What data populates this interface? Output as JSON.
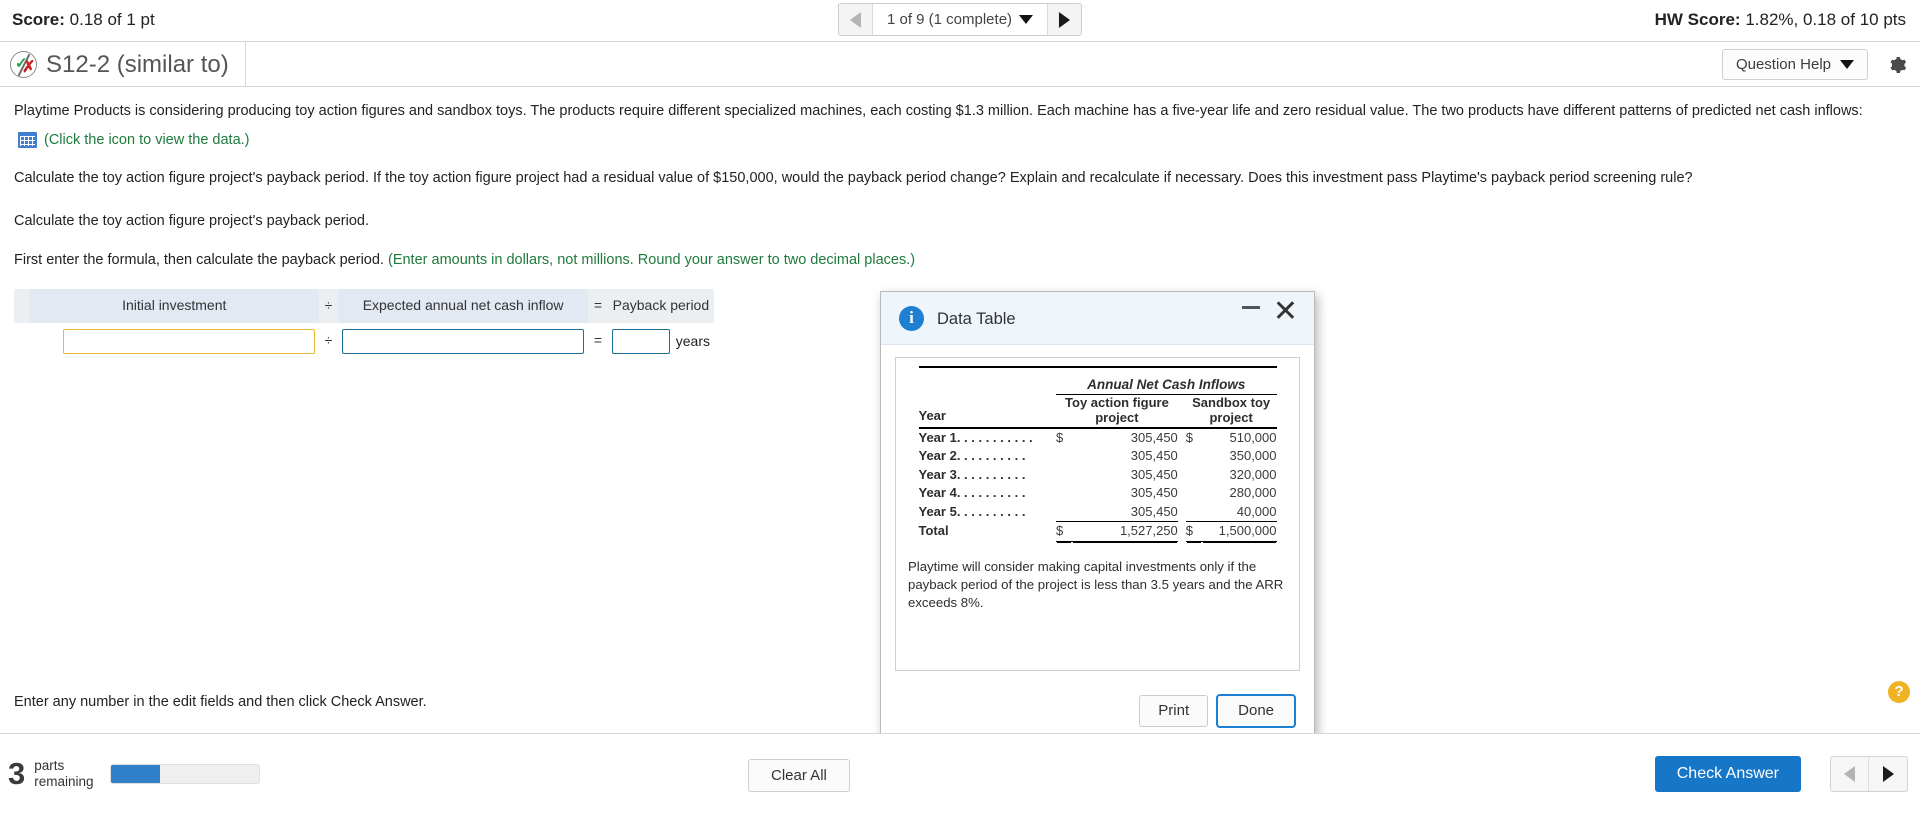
{
  "topbar": {
    "score_label": "Score:",
    "score_value": "0.18 of 1 pt",
    "hw_score_label": "HW Score:",
    "hw_score_value": "1.82%, 0.18 of 10 pts",
    "nav_label": "1 of 9 (1 complete)"
  },
  "question_header": {
    "title": "S12-2 (similar to)",
    "help_button": "Question Help"
  },
  "problem": {
    "paragraph": "Playtime Products is considering producing toy action figures and sandbox toys. The products require different specialized machines, each costing $1.3 million. Each machine has a five-year life and zero residual value. The two products have different patterns of predicted net cash inflows:",
    "data_link": "(Click the icon to view the data.)",
    "question": "Calculate the toy action figure project's payback period. If the toy action figure project had a residual value of $150,000, would the payback period change? Explain and recalculate if necessary. Does this investment pass Playtime's payback period screening rule?",
    "subquestion": "Calculate the toy action figure project's payback period.",
    "instruction_black": "First enter the formula, then calculate the payback period. ",
    "instruction_green": "(Enter amounts in dollars, not millions. Round your answer to two decimal places.)"
  },
  "formula": {
    "header_initial": "Initial investment",
    "op_divide": "÷",
    "header_inflow": "Expected annual net cash inflow",
    "op_equals": "=",
    "header_payback": "Payback period",
    "value_initial": "",
    "value_inflow": "",
    "value_payback": "",
    "unit": "years"
  },
  "modal": {
    "title": "Data Table",
    "group_header": "Annual Net Cash Inflows",
    "col_year": "Year",
    "col_toy": "Toy action figure project",
    "col_toy_line1": "Toy action figure",
    "col_toy_line2": "project",
    "col_sandbox_line1": "Sandbox toy",
    "col_sandbox_line2": "project",
    "currency": "$",
    "rows": [
      {
        "label": "Year 1. . . . . . . . . . .",
        "toy": "305,450",
        "sandbox": "510,000",
        "show_currency": true
      },
      {
        "label": "Year 2. . . . . . . . . .",
        "toy": "305,450",
        "sandbox": "350,000",
        "show_currency": false
      },
      {
        "label": "Year 3. . . . . . . . . .",
        "toy": "305,450",
        "sandbox": "320,000",
        "show_currency": false
      },
      {
        "label": "Year 4. . . . . . . . . .",
        "toy": "305,450",
        "sandbox": "280,000",
        "show_currency": false
      },
      {
        "label": "Year 5. . . . . . . . . .",
        "toy": "305,450",
        "sandbox": "40,000",
        "show_currency": false
      }
    ],
    "total_label": "Total",
    "total_toy": "1,527,250",
    "total_sandbox": "1,500,000",
    "note": "Playtime will consider making capital investments only if the payback period of the project is less than 3.5 years and the ARR exceeds 8%.",
    "print_button": "Print",
    "done_button": "Done"
  },
  "footer": {
    "enter_note": "Enter any number in the edit fields and then click Check Answer.",
    "parts_count": "3",
    "parts_label_line1": "parts",
    "parts_label_line2": "remaining",
    "clear_all": "Clear All",
    "check_answer": "Check Answer",
    "help_fab": "?"
  },
  "chart_data": {
    "type": "table",
    "title": "Annual Net Cash Inflows",
    "categories": [
      "Year 1",
      "Year 2",
      "Year 3",
      "Year 4",
      "Year 5"
    ],
    "series": [
      {
        "name": "Toy action figure project",
        "values": [
          305450,
          305450,
          305450,
          305450,
          305450
        ],
        "total": 1527250
      },
      {
        "name": "Sandbox toy project",
        "values": [
          510000,
          350000,
          320000,
          280000,
          40000
        ],
        "total": 1500000
      }
    ],
    "xlabel": "Year",
    "ylabel": "Annual Net Cash Inflows ($)"
  }
}
